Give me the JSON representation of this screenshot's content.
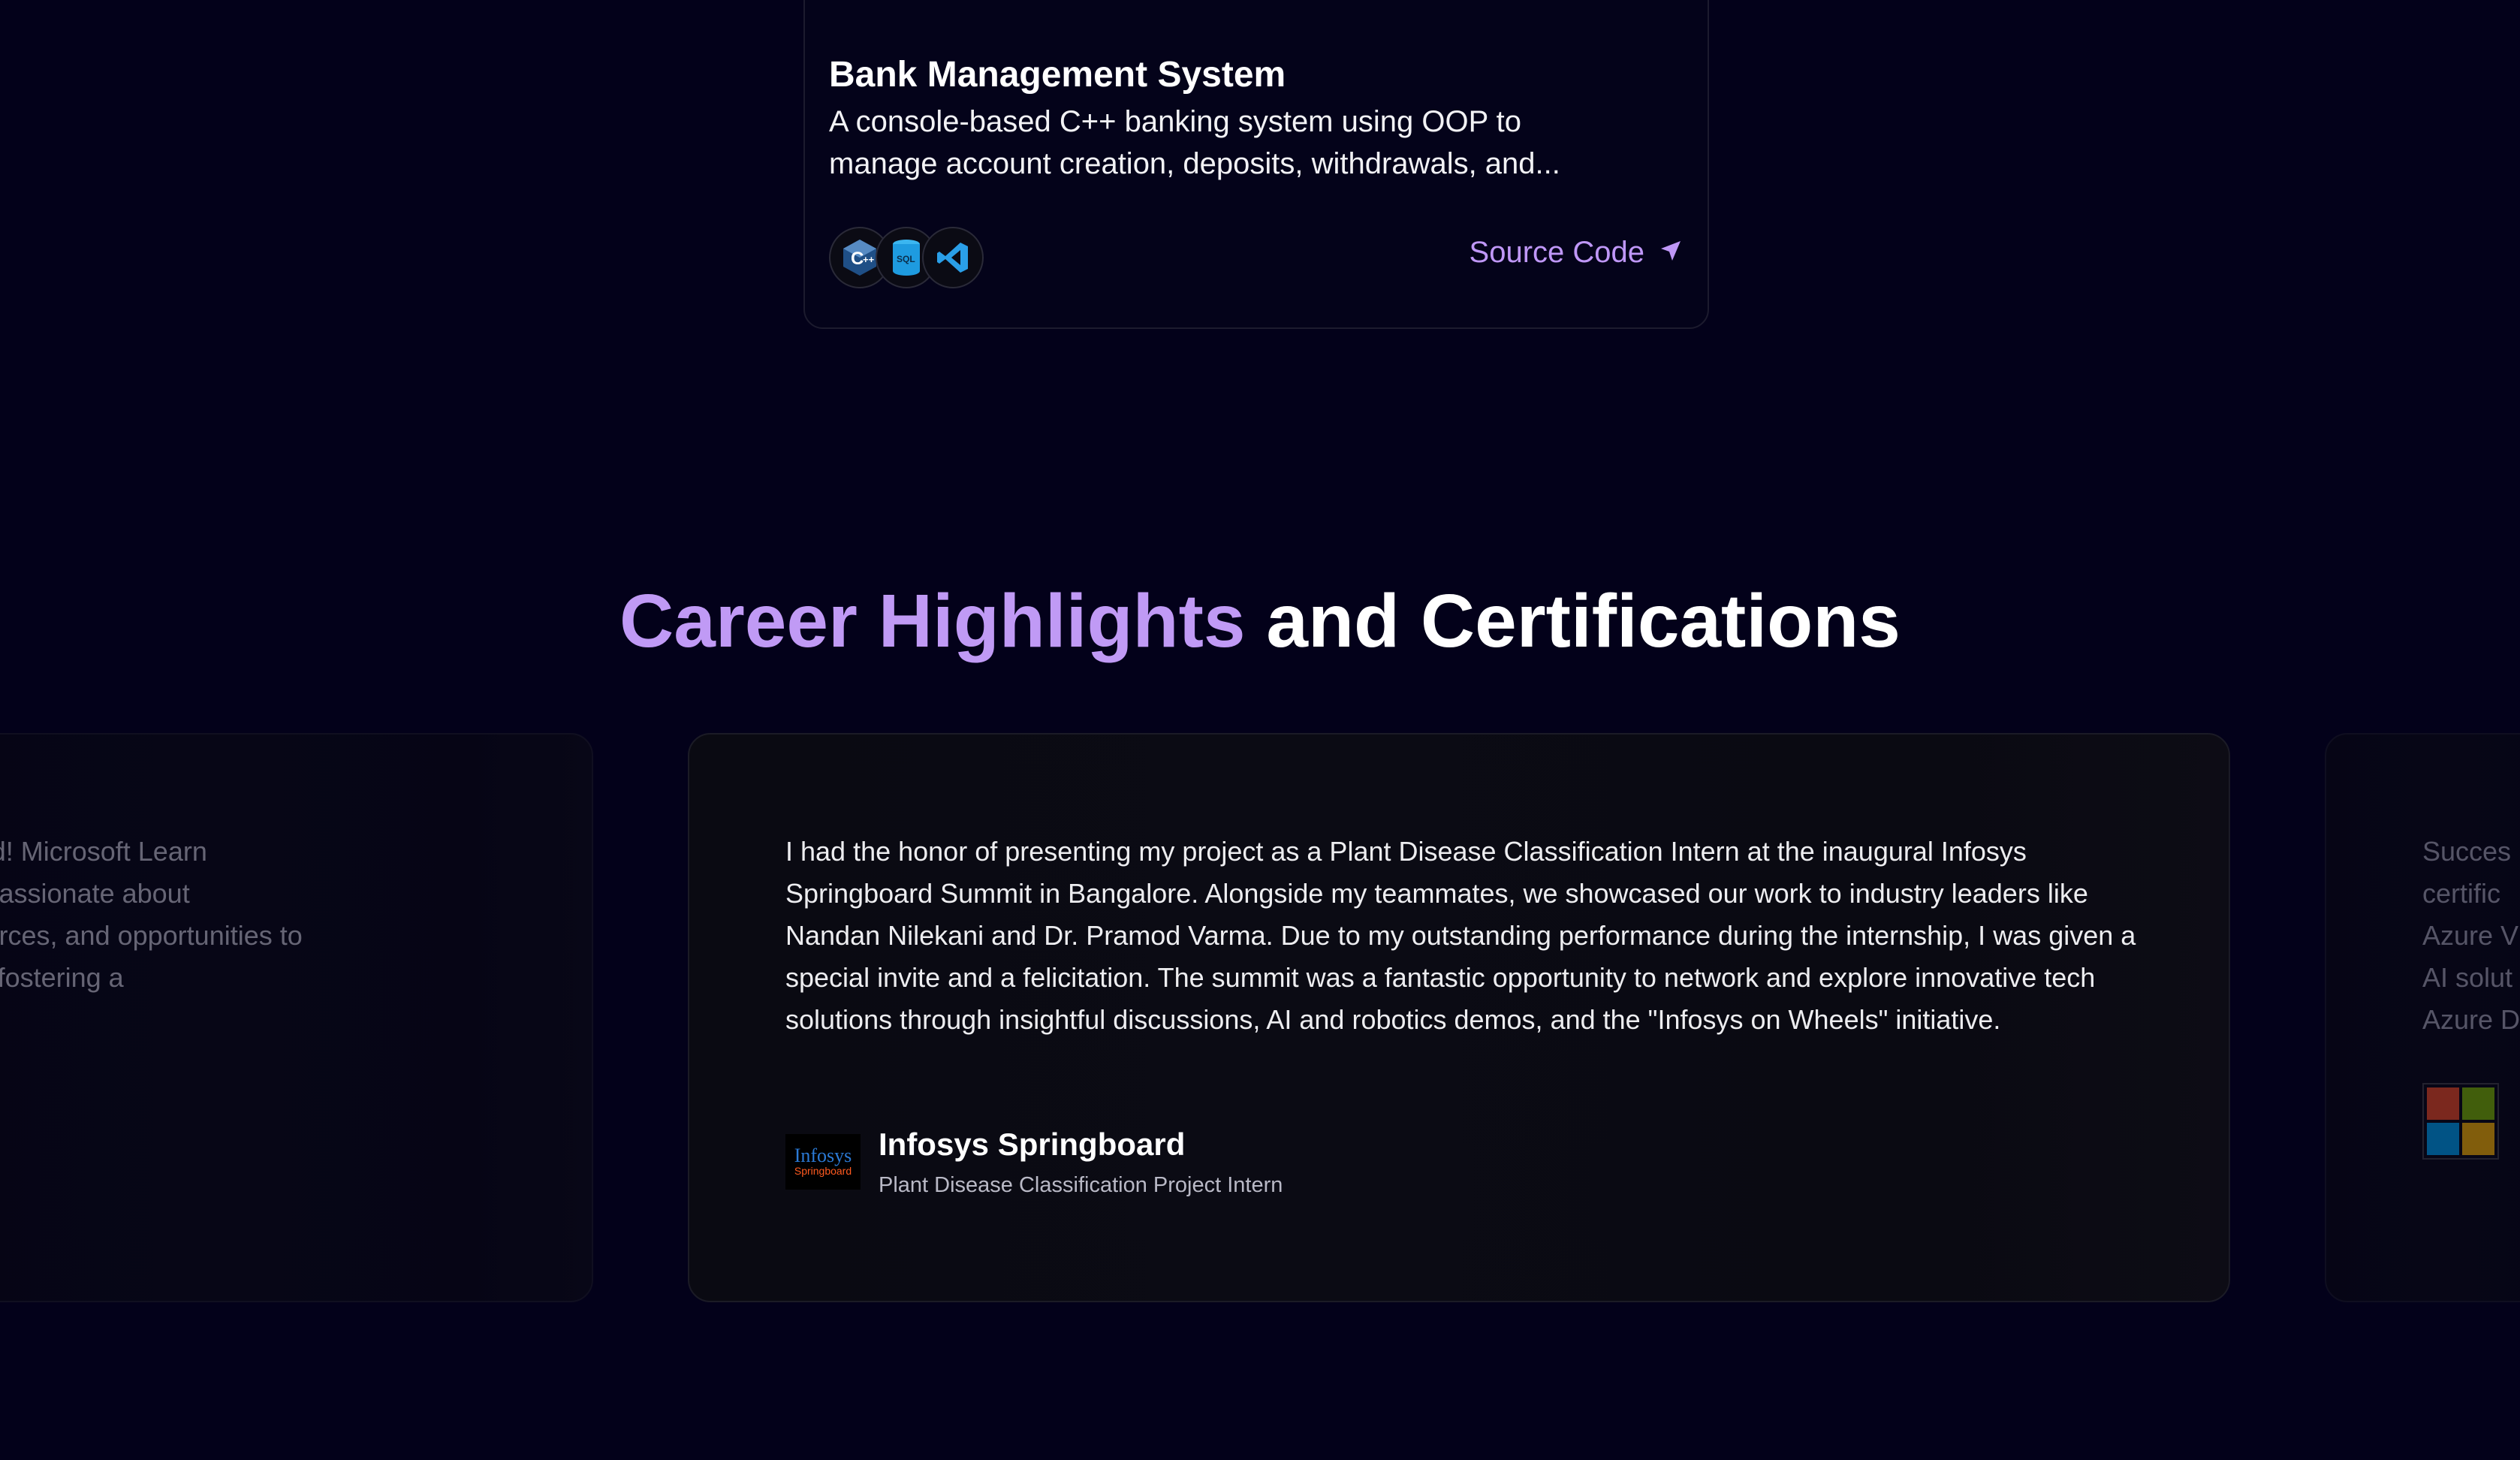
{
  "project": {
    "title": "Bank Management System",
    "description": "A console-based C++ banking system using OOP to manage account creation, deposits, withdrawals, and...",
    "tech_icons": [
      "cplusplus-icon",
      "sql-database-icon",
      "vscode-icon"
    ],
    "source_label": "Source Code"
  },
  "section": {
    "title_accent": "Career Highlights",
    "title_rest": "and Certifications"
  },
  "highlights": {
    "left": {
      "text_lines": [
        "Microsoft Learn Student Ambassador at IIIT Dharwad! Microsoft Learn",
        "Student Ambassadors are student leaders who are passionate about",
        "technology and help their peers gain the skills, resources, and opportunities to",
        "work on real-world tech projects. We're dedicated to fostering a"
      ]
    },
    "main": {
      "text": "I had the honor of presenting my project as a Plant Disease Classification Intern at the inaugural Infosys Springboard Summit in Bangalore. Alongside my teammates, we showcased our work to industry leaders like Nandan Nilekani and Dr. Pramod Varma. Due to my outstanding performance during the internship, I was given a special invite and a felicitation. The summit was a fantastic opportunity to network and explore innovative tech solutions through insightful discussions, AI and robotics demos, and the \"Infosys on Wheels\" initiative.",
      "author_name": "Infosys Springboard",
      "author_role": "Plant Disease Classification Project Intern",
      "logo_line1": "Infosys",
      "logo_line2": "Springboard"
    },
    "right": {
      "text_lines": [
        "Succes",
        "certific",
        "Azure V",
        "AI solut",
        "Azure D"
      ],
      "logo_colors": [
        "#f25022",
        "#7fba00",
        "#00a4ef",
        "#ffb900"
      ]
    }
  },
  "colors": {
    "accent": "#c09af5",
    "background": "#03011a"
  }
}
